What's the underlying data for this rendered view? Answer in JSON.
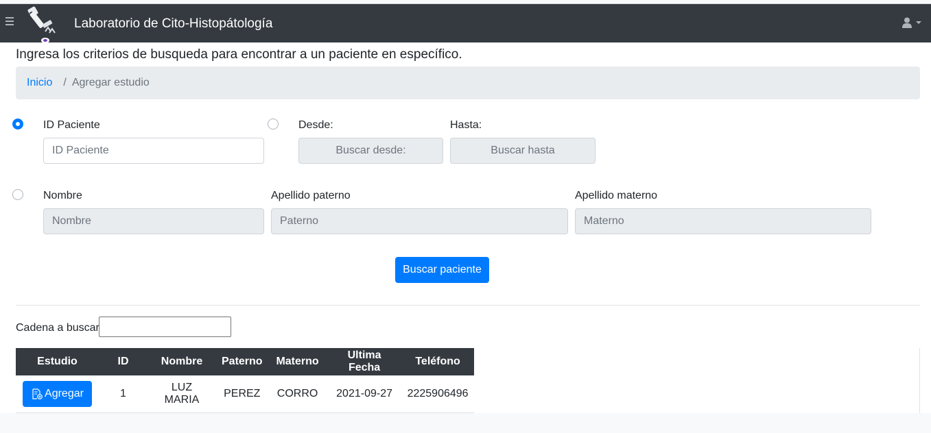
{
  "navbar": {
    "brand": "Laboratorio de Cito-Histopátología"
  },
  "page": {
    "lead": "Ingresa los criterios de busqueda para encontrar a un paciente en específico."
  },
  "breadcrumb": {
    "home": "Inicio",
    "separator": "/",
    "current": "Agregar estudio"
  },
  "form": {
    "id_label": "ID Paciente",
    "id_placeholder": "ID Paciente",
    "desde_label": "Desde:",
    "desde_placeholder": "Buscar desde:",
    "hasta_label": "Hasta:",
    "hasta_placeholder": "Buscar hasta",
    "nombre_label": "Nombre",
    "nombre_placeholder": "Nombre",
    "paterno_label": "Apellido paterno",
    "paterno_placeholder": "Paterno",
    "materno_label": "Apellido materno",
    "materno_placeholder": "Materno",
    "submit_label": "Buscar paciente",
    "selected_criterion": "ID Paciente"
  },
  "filter": {
    "label": "Cadena a buscar",
    "value": ""
  },
  "table": {
    "headers": [
      "Estudio",
      "ID",
      "Nombre",
      "Paterno",
      "Materno",
      "Ultima Fecha",
      "Teléfono"
    ],
    "rows": [
      {
        "action_label": "Agregar",
        "id": "1",
        "nombre": "LUZ MARIA",
        "paterno": "PEREZ",
        "materno": "CORRO",
        "ultima_fecha": "2021-09-27",
        "telefono": "2225906496"
      }
    ]
  },
  "colors": {
    "navbar_bg": "#343a40",
    "primary": "#007bff",
    "breadcrumb_bg": "#e9ecef"
  },
  "icons": {
    "menu": "hamburger-icon",
    "logo": "microscope-logo",
    "user": "user-icon",
    "add": "document-add-icon"
  }
}
